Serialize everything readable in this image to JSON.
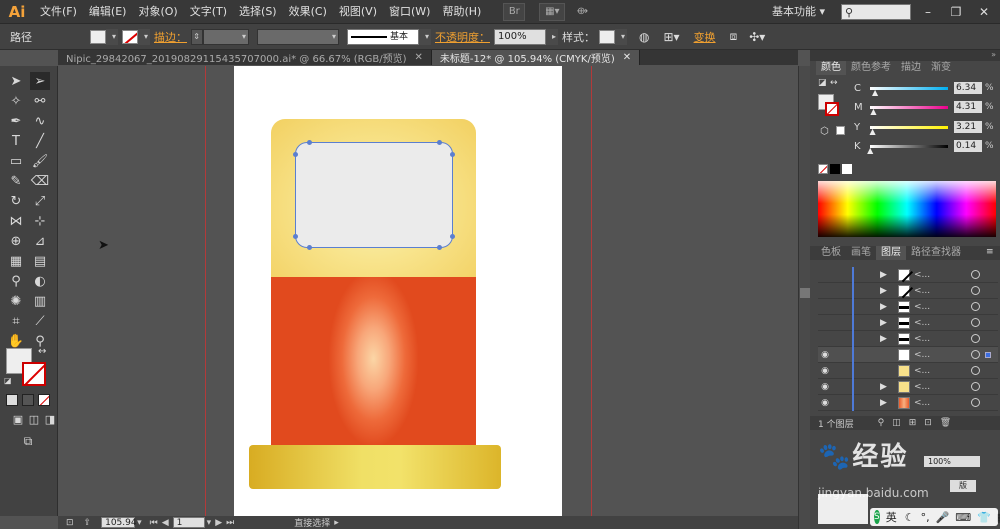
{
  "menubar": {
    "logo": "Ai",
    "items": [
      "文件(F)",
      "编辑(E)",
      "对象(O)",
      "文字(T)",
      "选择(S)",
      "效果(C)",
      "视图(V)",
      "窗口(W)",
      "帮助(H)"
    ],
    "workspace": "基本功能",
    "minimize": "–",
    "restore": "❐",
    "close": "✕"
  },
  "control": {
    "mode_label": "路径",
    "stroke_label": "描边：",
    "stroke_style": "基本",
    "opacity_label": "不透明度：",
    "opacity_value": "100%",
    "style_label": "样式：",
    "transform_label": "变换"
  },
  "tabs": [
    {
      "label": "Nipic_29842067_20190829115435707000.ai* @ 66.67% (RGB/预览)",
      "close": "✕"
    },
    {
      "label": "未标题-12* @ 105.94% (CMYK/预览)",
      "close": "✕"
    }
  ],
  "status": {
    "zoom": "105.94",
    "page": "1",
    "tool_name": "直接选择"
  },
  "color_panel": {
    "tabs": [
      "颜色",
      "颜色参考",
      "描边",
      "渐变"
    ],
    "channels": [
      {
        "label": "C",
        "value": "6.34",
        "pct": "%",
        "pos": 0.0634,
        "color": "#00aeef"
      },
      {
        "label": "M",
        "value": "4.31",
        "pct": "%",
        "pos": 0.0431,
        "color": "#ec008c"
      },
      {
        "label": "Y",
        "value": "3.21",
        "pct": "%",
        "pos": 0.0321,
        "color": "#fff200"
      },
      {
        "label": "K",
        "value": "0.14",
        "pct": "%",
        "pos": 0.0014,
        "color": "#000000"
      }
    ]
  },
  "layers_panel": {
    "tabs": [
      "色板",
      "画笔",
      "图层",
      "路径查找器"
    ],
    "rows": [
      {
        "name": "<...",
        "visible": false,
        "thumb": "diag",
        "arrow": true
      },
      {
        "name": "<...",
        "visible": false,
        "thumb": "diag",
        "arrow": true
      },
      {
        "name": "<...",
        "visible": false,
        "thumb": "bars",
        "arrow": true
      },
      {
        "name": "<...",
        "visible": false,
        "thumb": "bars",
        "arrow": true
      },
      {
        "name": "<...",
        "visible": false,
        "thumb": "bars",
        "arrow": true
      },
      {
        "name": "<...",
        "visible": true,
        "thumb": "white",
        "arrow": false,
        "selected": true
      },
      {
        "name": "<...",
        "visible": true,
        "thumb": "yellow",
        "arrow": false
      },
      {
        "name": "<...",
        "visible": true,
        "thumb": "yellow",
        "arrow": true
      },
      {
        "name": "<...",
        "visible": true,
        "thumb": "red",
        "arrow": true
      }
    ],
    "footer_count": "1 个图层"
  },
  "watermark": {
    "text": "经验",
    "url": "jingyan.baidu.com"
  },
  "taskbar": {
    "ime": "英"
  },
  "colors": {
    "yellow_top": "#f6d86a",
    "red_body": "#e8582a",
    "base_gold": "#e4c233",
    "screen_gray": "#ebebeb"
  }
}
